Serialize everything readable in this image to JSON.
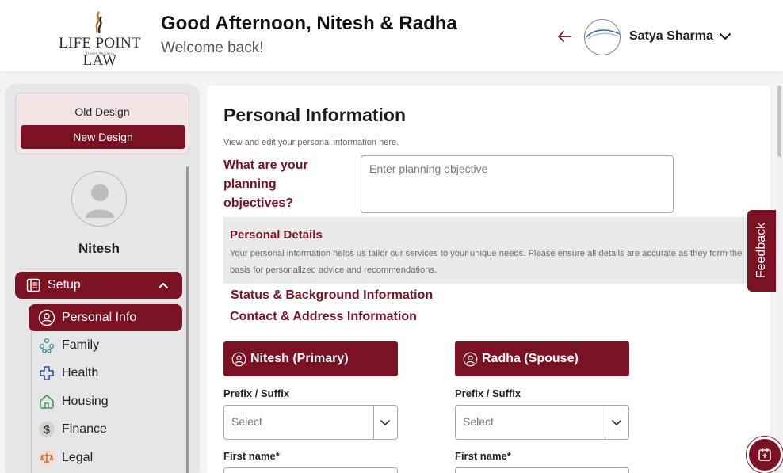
{
  "header": {
    "brand": "LIFE POINT LAW",
    "brand_tagline": "Trusted Attorneys",
    "greeting": "Good Afternoon, Nitesh & Radha",
    "welcome": "Welcome back!",
    "user_name": "Satya Sharma"
  },
  "design_switch": {
    "old_label": "Old Design",
    "new_label": "New Design"
  },
  "sidebar": {
    "profile_name": "Nitesh",
    "setup_label": "Setup",
    "items": [
      {
        "label": "Personal Info",
        "icon": "user-circle-icon",
        "active": true
      },
      {
        "label": "Family",
        "icon": "family-tree-icon"
      },
      {
        "label": "Health",
        "icon": "health-cross-icon"
      },
      {
        "label": "Housing",
        "icon": "home-icon"
      },
      {
        "label": "Finance",
        "icon": "dollar-icon"
      },
      {
        "label": "Legal",
        "icon": "scales-icon"
      }
    ]
  },
  "main": {
    "title": "Personal Information",
    "subtitle": "View and edit your personal information here.",
    "objective_question": "What are your planning objectives?",
    "objective_placeholder": "Enter planning objective",
    "personal_details_title": "Personal Details",
    "personal_details_text": "Your personal information helps us tailor our services to your unique needs. Please ensure all details are accurate as they form the basis for personalized advice and recommendations.",
    "section_status": "Status & Background Information",
    "section_contact": "Contact & Address Information",
    "primary_header": "Nitesh (Primary)",
    "spouse_header": "Radha (Spouse)",
    "prefix_label": "Prefix / Suffix",
    "select_placeholder": "Select",
    "first_name_label": "First name*"
  },
  "feedback_label": "Feedback",
  "colors": {
    "brand": "#7a1224",
    "panel": "#e6e6e8",
    "band": "#eaeaea"
  }
}
